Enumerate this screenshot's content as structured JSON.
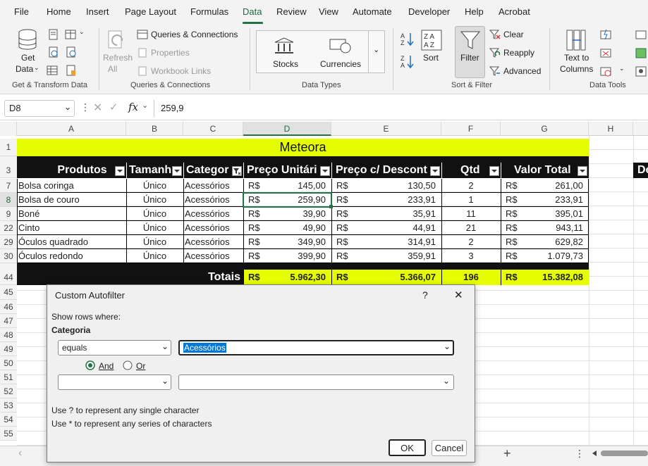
{
  "menu": {
    "items": [
      "File",
      "Home",
      "Insert",
      "Page Layout",
      "Formulas",
      "Data",
      "Review",
      "View",
      "Automate",
      "Developer",
      "Help",
      "Acrobat"
    ],
    "active": "Data"
  },
  "ribbon": {
    "get_data": "Get",
    "get_data2": "Data",
    "refresh": "Refresh",
    "refresh_all": "All",
    "queries": "Queries & Connections",
    "properties": "Properties",
    "workbook_links": "Workbook Links",
    "stocks": "Stocks",
    "currencies": "Currencies",
    "sort": "Sort",
    "filter": "Filter",
    "clear": "Clear",
    "reapply": "Reapply",
    "advanced": "Advanced",
    "text_to": "Text to",
    "columns": "Columns",
    "groups": {
      "get_transform": "Get & Transform Data",
      "queries": "Queries & Connections",
      "data_types": "Data Types",
      "sort_filter": "Sort & Filter",
      "data_tools": "Data Tools"
    }
  },
  "formula_bar": {
    "name_box": "D8",
    "fx": "fx",
    "value": "259,9"
  },
  "columns": [
    "A",
    "B",
    "C",
    "D",
    "E",
    "F",
    "G",
    "H"
  ],
  "rows": [
    "1",
    "3",
    "7",
    "8",
    "9",
    "22",
    "29",
    "30",
    "",
    "44",
    "45",
    "46",
    "47",
    "48",
    "49",
    "50",
    "51",
    "52",
    "53",
    "54",
    "55"
  ],
  "sheet": {
    "title": "Meteora",
    "headers": [
      "Produtos",
      "Tamanh",
      "Categor",
      "Preço Unitári",
      "Preço c/ Descont",
      "Qtd",
      "Valor Total"
    ],
    "data": [
      [
        "Bolsa coringa",
        "Único",
        "Acessórios",
        "R$",
        "145,00",
        "R$",
        "130,50",
        "2",
        "R$",
        "261,00"
      ],
      [
        "Bolsa de couro",
        "Único",
        "Acessórios",
        "R$",
        "259,90",
        "R$",
        "233,91",
        "1",
        "R$",
        "233,91"
      ],
      [
        "Boné",
        "Único",
        "Acessórios",
        "R$",
        "39,90",
        "R$",
        "35,91",
        "11",
        "R$",
        "395,01"
      ],
      [
        "Cinto",
        "Único",
        "Acessórios",
        "R$",
        "49,90",
        "R$",
        "44,91",
        "21",
        "R$",
        "943,11"
      ],
      [
        "Óculos quadrado",
        "Único",
        "Acessórios",
        "R$",
        "349,90",
        "R$",
        "314,91",
        "2",
        "R$",
        "629,82"
      ],
      [
        "Óculos redondo",
        "Único",
        "Acessórios",
        "R$",
        "399,90",
        "R$",
        "359,91",
        "3",
        "R$",
        "1.079,73"
      ]
    ],
    "totals": {
      "label": "Totais",
      "cur1": "R$",
      "d": "5.962,30",
      "cur2": "R$",
      "e": "5.366,07",
      "f": "196",
      "cur3": "R$",
      "g": "15.382,08"
    },
    "right_partial": "De"
  },
  "dialog": {
    "title": "Custom Autofilter",
    "help": "?",
    "close": "✕",
    "show_rows": "Show rows where:",
    "field": "Categoria",
    "op1": "equals",
    "val1": "Acessórios",
    "and": "And",
    "or": "Or",
    "op2": "",
    "val2": "",
    "hint1": "Use ? to represent any single character",
    "hint2": "Use * to represent any series of characters",
    "ok": "OK",
    "cancel": "Cancel"
  },
  "colors": {
    "accent": "#217346",
    "yellow": "#e6ff00",
    "header_bg": "#111111"
  }
}
